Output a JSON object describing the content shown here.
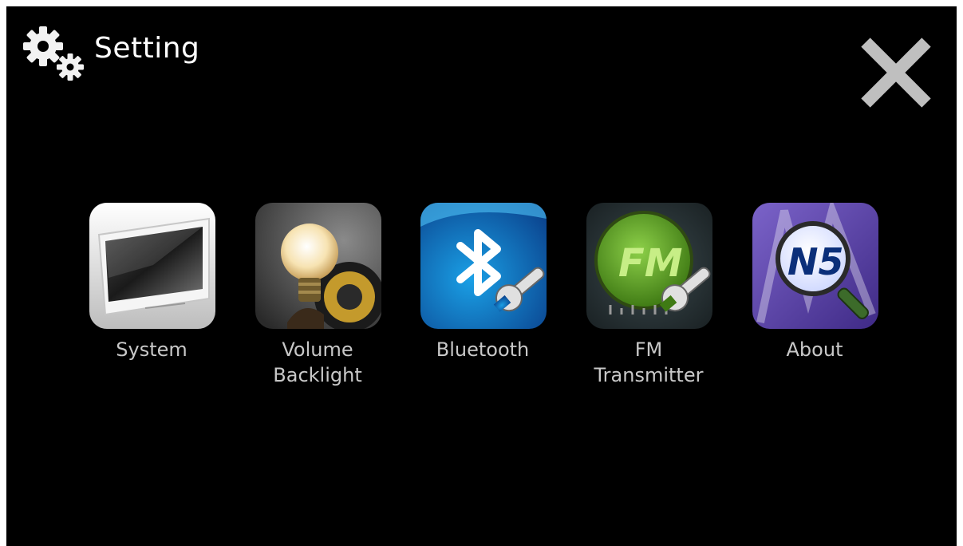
{
  "header": {
    "title": "Setting",
    "gear_icon": "gears-icon",
    "close_icon": "close-icon"
  },
  "tiles": [
    {
      "label": "System",
      "icon": "system-icon",
      "accent": "#d8d8d8"
    },
    {
      "label": "Volume\nBacklight",
      "icon": "volume-backlight-icon",
      "accent": "#e8c777"
    },
    {
      "label": "Bluetooth",
      "icon": "bluetooth-icon",
      "accent": "#1e8fd6"
    },
    {
      "label": "FM\nTransmitter",
      "icon": "fm-transmitter-icon",
      "accent": "#6bb72f"
    },
    {
      "label": "About",
      "icon": "about-icon",
      "accent": "#6a4fb3"
    }
  ],
  "colors": {
    "background": "#000000",
    "label": "#c8c8c8",
    "title": "#ffffff",
    "close": "#bfbfbf"
  }
}
